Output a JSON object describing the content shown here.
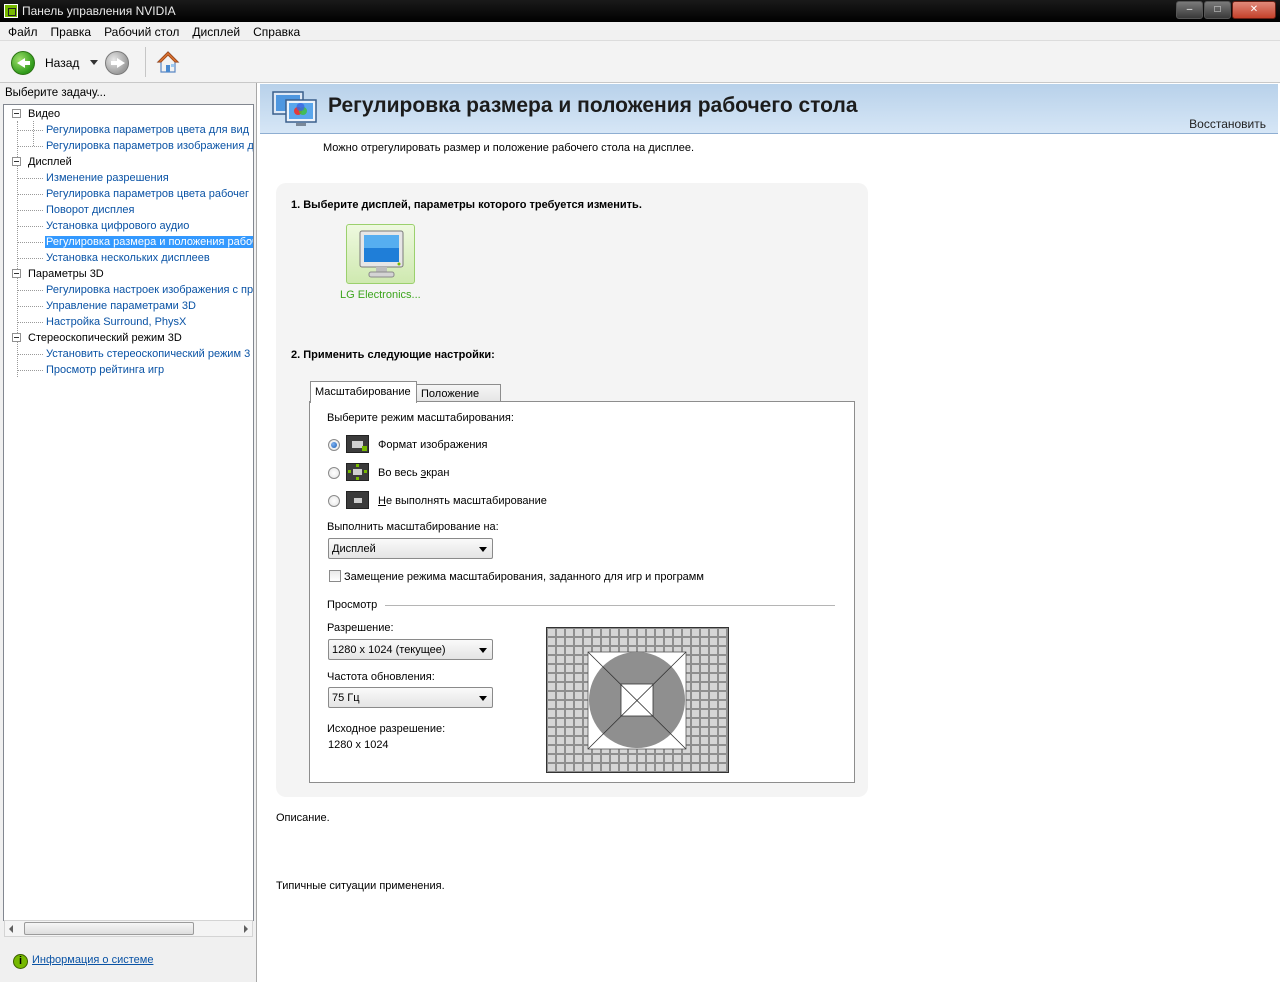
{
  "window": {
    "title": "Панель управления NVIDIA",
    "controls": [
      "–",
      "□",
      "✕"
    ]
  },
  "menu": [
    "Файл",
    "Правка",
    "Рабочий стол",
    "Дисплей",
    "Справка"
  ],
  "toolbar": {
    "back_label": "Назад"
  },
  "sidebar": {
    "task_label": "Выберите задачу...",
    "categories": [
      {
        "label": "Видео",
        "items": [
          "Регулировка параметров цвета для вид",
          "Регулировка параметров изображения д"
        ]
      },
      {
        "label": "Дисплей",
        "items": [
          "Изменение разрешения",
          "Регулировка параметров цвета рабочег",
          "Поворот дисплея",
          "Установка цифрового аудио",
          "Регулировка размера и положения рабоч",
          "Установка нескольких дисплеев"
        ]
      },
      {
        "label": "Параметры 3D",
        "items": [
          "Регулировка настроек изображения с пр",
          "Управление параметрами 3D",
          "Настройка Surround, PhysX"
        ]
      },
      {
        "label": "Стереоскопический режим 3D",
        "items": [
          "Установить стереоскопический режим 3",
          "Просмотр рейтинга игр"
        ]
      }
    ],
    "selected_item": "Регулировка размера и положения рабоч",
    "sysinfo_link": "Информация о системе"
  },
  "main": {
    "title": "Регулировка размера и положения рабочего стола",
    "restore_label": "Восстановить",
    "intro": "Можно отрегулировать размер и положение рабочего стола на дисплее.",
    "step1": "1. Выберите дисплей, параметры которого требуется изменить.",
    "display_name": "LG Electronics...",
    "step2": "2. Применить следующие настройки:",
    "tabs": [
      "Масштабирование",
      "Положение"
    ],
    "scaling": {
      "mode_label": "Выберите режим масштабирования:",
      "options": [
        {
          "label": "Формат изображения",
          "selected": true
        },
        {
          "label": "Во весь экран",
          "selected": false
        },
        {
          "label": "Не выполнять масштабирование",
          "selected": false
        }
      ],
      "perform_on_label": "Выполнить масштабирование на:",
      "perform_on_value": "Дисплей",
      "override_label": "Замещение режима масштабирования, заданного для игр и программ",
      "override_checked": false
    },
    "preview": {
      "label": "Просмотр",
      "resolution_label": "Разрешение:",
      "resolution_value": "1280 x 1024 (текущее)",
      "refresh_label": "Частота обновления:",
      "refresh_value": "75 Гц",
      "native_label": "Исходное разрешение:",
      "native_value": "1280 x 1024"
    },
    "description_label": "Описание.",
    "typical_label": "Типичные ситуации применения."
  },
  "colors": {
    "nvidia_green": "#76b900",
    "link_blue": "#0a53a5",
    "selection_blue": "#3399ff",
    "header_blue": "#b8d1ea"
  }
}
